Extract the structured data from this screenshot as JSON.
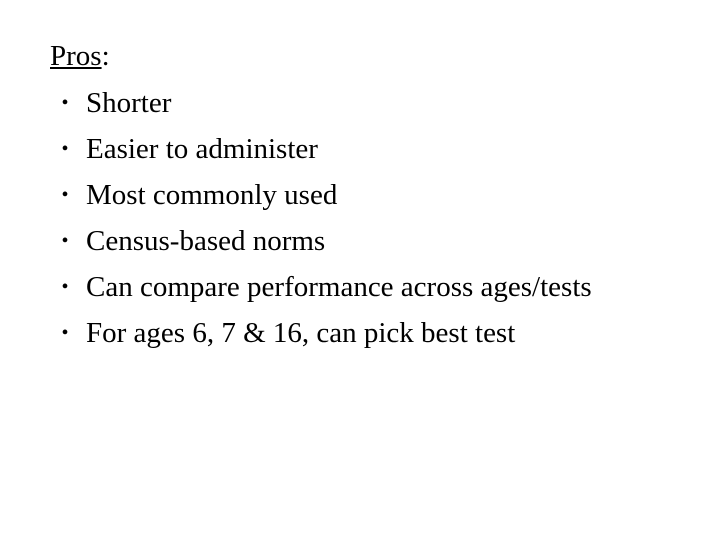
{
  "slide": {
    "background_color": "#ffffff",
    "text_color": "#000000",
    "heading": {
      "word": "Pros",
      "colon": ":",
      "underlined": true
    },
    "bullet_marker": "•",
    "bullets": [
      {
        "text": "Shorter"
      },
      {
        "text": "Easier to administer"
      },
      {
        "text": "Most commonly used"
      },
      {
        "text": "Census-based norms"
      },
      {
        "text": "Can compare performance across ages/tests"
      },
      {
        "text": "For ages 6, 7 & 16, can pick best test"
      }
    ]
  }
}
